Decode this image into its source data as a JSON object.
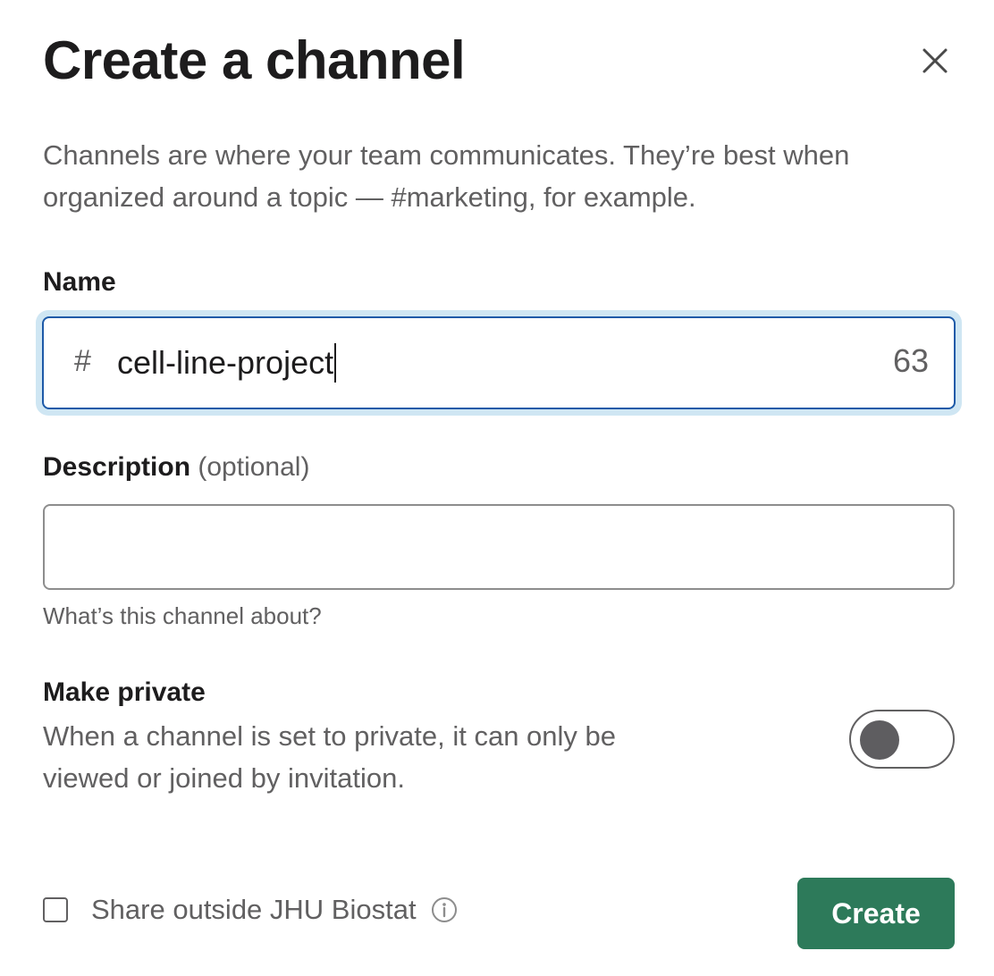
{
  "dialog": {
    "title": "Create a channel",
    "intro": "Channels are where your team communicates. They’re best when organized around a topic — #marketing, for example."
  },
  "name": {
    "label": "Name",
    "prefix": "#",
    "value": "cell-line-project",
    "remaining": "63"
  },
  "description": {
    "label": "Description",
    "optional": "(optional)",
    "value": "",
    "hint": "What’s this channel about?"
  },
  "private": {
    "label": "Make private",
    "description": "When a channel is set to private, it can only be viewed or joined by invitation.",
    "enabled": false
  },
  "share": {
    "label": "Share outside JHU Biostat",
    "checked": false
  },
  "actions": {
    "create_label": "Create"
  },
  "colors": {
    "primary_button": "#2d7a5a",
    "focus_ring": "#cfe6f3",
    "focus_border": "#1d5aa8",
    "muted_text": "#616061"
  },
  "icons": {
    "close": "close-icon",
    "info": "info-icon"
  }
}
